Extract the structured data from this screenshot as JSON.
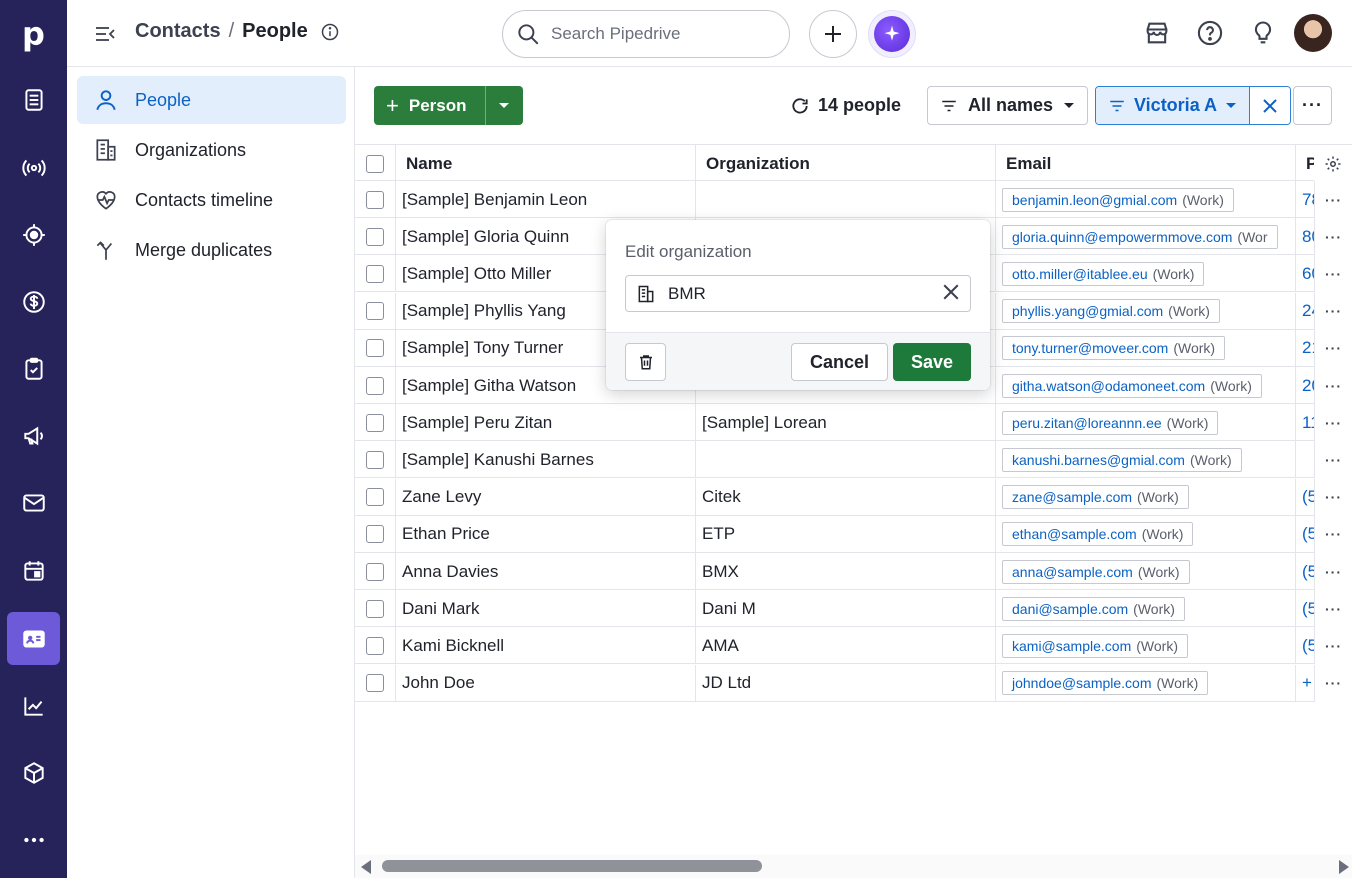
{
  "app": {
    "logo": "p"
  },
  "rail": {
    "items": [
      {
        "icon": "leads-icon"
      },
      {
        "icon": "broadcast-icon"
      },
      {
        "icon": "target-icon"
      },
      {
        "icon": "dollar-icon"
      },
      {
        "icon": "clipboard-check-icon"
      },
      {
        "icon": "megaphone-icon"
      },
      {
        "icon": "mail-icon"
      },
      {
        "icon": "calendar-icon"
      },
      {
        "icon": "contacts-card-icon",
        "active": true
      },
      {
        "icon": "chart-icon"
      },
      {
        "icon": "box-icon"
      },
      {
        "icon": "more-icon"
      }
    ]
  },
  "topbar": {
    "breadcrumb_parent": "Contacts",
    "breadcrumb_sep": "/",
    "breadcrumb_current": "People",
    "search_placeholder": "Search Pipedrive"
  },
  "subnav": {
    "items": [
      {
        "label": "People",
        "icon": "person-icon",
        "active": true
      },
      {
        "label": "Organizations",
        "icon": "building-icon"
      },
      {
        "label": "Contacts timeline",
        "icon": "heart-pulse-icon"
      },
      {
        "label": "Merge duplicates",
        "icon": "merge-icon"
      }
    ]
  },
  "toolbar": {
    "add_label": "Person",
    "count_label": "14 people",
    "name_filter_label": "All names",
    "owner_filter_label": "Victoria A",
    "more_label": "···"
  },
  "table": {
    "columns": [
      "Name",
      "Organization",
      "Email",
      "P"
    ],
    "rows": [
      {
        "name": "[Sample] Benjamin Leon",
        "org": "",
        "email": "benjamin.leon@gmial.com",
        "email_type": "(Work)",
        "phone": "78"
      },
      {
        "name": "[Sample] Gloria Quinn",
        "org": "",
        "email": "gloria.quinn@empowermmove.com",
        "email_type": "(Wor",
        "phone": "80"
      },
      {
        "name": "[Sample] Otto Miller",
        "org": "",
        "email": "otto.miller@itablee.eu",
        "email_type": "(Work)",
        "phone": "60"
      },
      {
        "name": "[Sample] Phyllis Yang",
        "org": "",
        "email": "phyllis.yang@gmial.com",
        "email_type": "(Work)",
        "phone": "24"
      },
      {
        "name": "[Sample] Tony Turner",
        "org": "",
        "email": "tony.turner@moveer.com",
        "email_type": "(Work)",
        "phone": "21"
      },
      {
        "name": "[Sample] Githa Watson",
        "org": "",
        "email": "githa.watson@odamoneet.com",
        "email_type": "(Work)",
        "phone": "20"
      },
      {
        "name": "[Sample] Peru Zitan",
        "org": "[Sample] Lorean",
        "email": "peru.zitan@loreannn.ee",
        "email_type": "(Work)",
        "phone": "11"
      },
      {
        "name": "[Sample] Kanushi Barnes",
        "org": "",
        "email": "kanushi.barnes@gmial.com",
        "email_type": "(Work)",
        "phone": ""
      },
      {
        "name": "Zane Levy",
        "org": "Citek",
        "email": "zane@sample.com",
        "email_type": "(Work)",
        "phone": "(5"
      },
      {
        "name": "Ethan Price",
        "org": "ETP",
        "email": "ethan@sample.com",
        "email_type": "(Work)",
        "phone": "(5"
      },
      {
        "name": "Anna Davies",
        "org": "BMX",
        "email": "anna@sample.com",
        "email_type": "(Work)",
        "phone": "(5"
      },
      {
        "name": "Dani Mark",
        "org": "Dani M",
        "email": "dani@sample.com",
        "email_type": "(Work)",
        "phone": "(5"
      },
      {
        "name": "Kami Bicknell",
        "org": "AMA",
        "email": "kami@sample.com",
        "email_type": "(Work)",
        "phone": "(5"
      },
      {
        "name": "John Doe",
        "org": "JD Ltd",
        "email": "johndoe@sample.com",
        "email_type": "(Work)",
        "phone": "+"
      }
    ]
  },
  "popover": {
    "title": "Edit organization",
    "value": "BMR",
    "cancel_label": "Cancel",
    "save_label": "Save"
  },
  "colors": {
    "rail_bg": "#26235b",
    "rail_active": "#6c5ad8",
    "primary_green": "#2a7d3b",
    "link_blue": "#0b62c4"
  }
}
